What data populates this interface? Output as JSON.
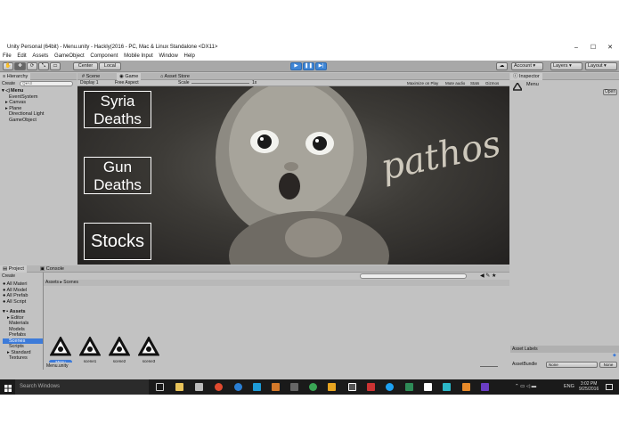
{
  "window": {
    "title": "Unity Personal (64bit) - Menu.unity - Hackly(2016 - PC, Mac & Linux Standalone <DX11>",
    "minimize": "–",
    "maximize": "☐",
    "close": "✕"
  },
  "menu": [
    "File",
    "Edit",
    "Assets",
    "GameObject",
    "Component",
    "Mobile Input",
    "Window",
    "Help"
  ],
  "toolbar": {
    "center": "Center",
    "local": "Local",
    "account": "Account",
    "layers": "Layers",
    "layout": "Layout"
  },
  "hierarchy": {
    "tab": "Hierarchy",
    "create": "Create",
    "search_placeholder": "Q▾All",
    "scene": "Menu",
    "items": [
      "EventSystem",
      "Canvas",
      "Plane",
      "Directional Light",
      "GameObject"
    ]
  },
  "center_tabs": [
    "Scene",
    "Game",
    "Asset Store"
  ],
  "game": {
    "display": "Display 1",
    "aspect": "Free Aspect",
    "scale_label": "Scale",
    "scale_value": "1x",
    "options": [
      "Maximize on Play",
      "Mute audio",
      "Stats",
      "Gizmos"
    ],
    "watermark": "pathos"
  },
  "buttons": [
    {
      "label": "Syria Deaths"
    },
    {
      "label": "Gun Deaths"
    },
    {
      "label": "Stocks"
    }
  ],
  "project": {
    "tabs": [
      "Project",
      "Console"
    ],
    "create": "Create",
    "favorites": [
      "All Materi",
      "All Model",
      "All Prefab",
      "All Script"
    ],
    "assets_label": "Assets",
    "folders": [
      "Editor",
      "Materials",
      "Models",
      "Prefabs",
      "Scenes",
      "Scripts",
      "Standard",
      "Textures"
    ],
    "breadcrumb": "Assets ▸ Scenes",
    "items": [
      "Menu",
      "scene1",
      "scene2",
      "scene3"
    ],
    "status": "Menu.unity"
  },
  "inspector": {
    "tab": "Inspector",
    "name": "Menu",
    "open": "Open",
    "asset_labels": "Asset Labels",
    "assetbundle": "AssetBundle",
    "none": "None",
    "none2": "None"
  },
  "taskbar": {
    "search": "Search Windows",
    "lang": "ENG",
    "time": "3:02 PM",
    "date": "9/25/2016"
  }
}
